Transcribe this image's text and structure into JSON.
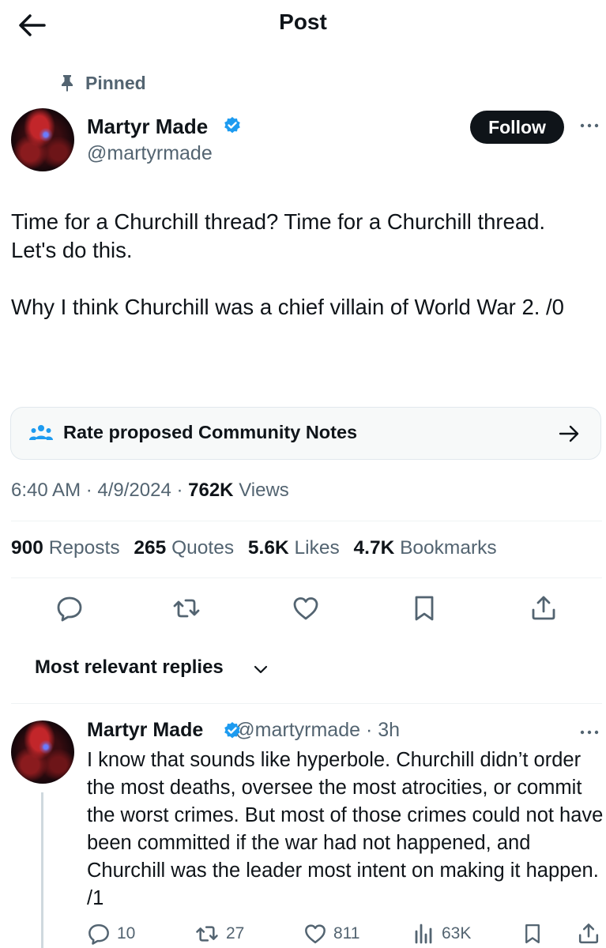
{
  "header": {
    "title": "Post"
  },
  "pinned": {
    "label": "Pinned"
  },
  "author": {
    "name": "Martyr Made",
    "handle": "@martyrmade"
  },
  "follow": {
    "label": "Follow"
  },
  "post": {
    "paragraph1": "Time for a Churchill thread? Time for a Churchill thread. Let's do this.",
    "paragraph2": "Why I think Churchill was a chief villain of World War 2. /0"
  },
  "community_notes": {
    "label": "Rate proposed Community Notes"
  },
  "meta": {
    "time": "6:40 AM",
    "date": "4/9/2024",
    "views_count": "762K",
    "views_label": "Views"
  },
  "stats": {
    "reposts_count": "900",
    "reposts_label": "Reposts",
    "quotes_count": "265",
    "quotes_label": "Quotes",
    "likes_count": "5.6K",
    "likes_label": "Likes",
    "bookmarks_count": "4.7K",
    "bookmarks_label": "Bookmarks"
  },
  "replies_filter": {
    "label": "Most relevant replies"
  },
  "reply": {
    "name": "Martyr Made",
    "handle": "@martyrmade",
    "time": "3h",
    "text": "I know that sounds like hyperbole. Churchill didn’t order the most deaths, oversee the most atrocities, or commit the worst crimes. But most of those crimes could not have been committed if the war had not happened, and Churchill was the leader most intent on making it happen. /1",
    "replies": "10",
    "reposts": "27",
    "likes": "811",
    "views": "63K"
  },
  "colors": {
    "text": "#0f1419",
    "secondary": "#536471",
    "verified": "#1d9bf0",
    "divider": "#eff3f4"
  }
}
